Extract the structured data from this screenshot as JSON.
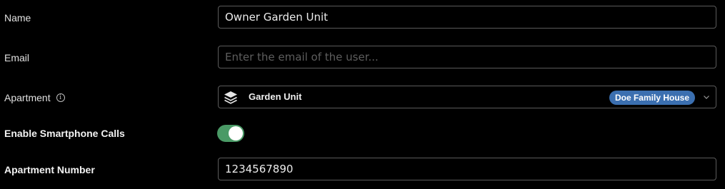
{
  "form": {
    "name": {
      "label": "Name",
      "value": "Owner Garden Unit"
    },
    "email": {
      "label": "Email",
      "value": "",
      "placeholder": "Enter the email of the user..."
    },
    "apartment": {
      "label": "Apartment",
      "info_icon": "info-icon",
      "selected": "Garden Unit",
      "badge": "Doe Family House",
      "icon": "layers-icon"
    },
    "smartphone_calls": {
      "label": "Enable Smartphone Calls",
      "enabled": true
    },
    "apartment_number": {
      "label": "Apartment Number",
      "value": "1234567890"
    }
  },
  "colors": {
    "toggle_on": "#4a9a66",
    "badge": "#3b6fb0",
    "border": "#5b5b5b"
  }
}
